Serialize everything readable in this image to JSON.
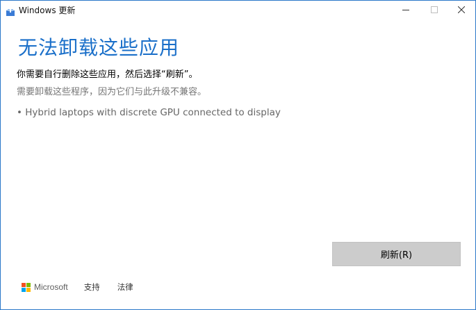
{
  "window": {
    "title": "Windows 更新",
    "controls": {
      "minimize": "—",
      "maximize": "☐",
      "close": "✕"
    }
  },
  "main": {
    "heading": "无法卸载这些应用",
    "instruction": "你需要自行删除这些应用，然后选择“刷新”。",
    "reason": "需要卸载这些程序，因为它们与此升级不兼容。",
    "apps": [
      "• Hybrid laptops with discrete GPU connected to display"
    ],
    "refresh_label": "刷新(R)"
  },
  "footer": {
    "brand": "Microsoft",
    "support_label": "支持",
    "legal_label": "法律"
  },
  "colors": {
    "accent": "#1a6fc9",
    "window_border": "#2b78c9",
    "button_bg": "#cccccc",
    "ms_red": "#f25022",
    "ms_green": "#7fba00",
    "ms_blue": "#00a4ef",
    "ms_yellow": "#ffb900"
  }
}
